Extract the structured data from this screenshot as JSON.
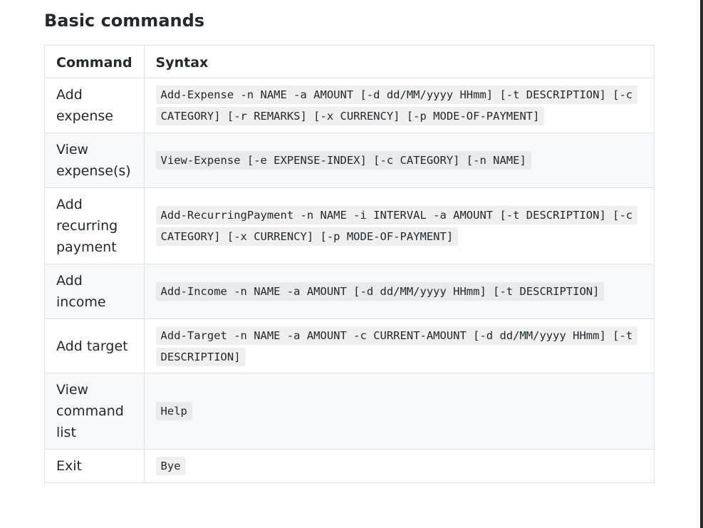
{
  "heading": "Basic commands",
  "table": {
    "headers": {
      "command": "Command",
      "syntax": "Syntax"
    },
    "rows": [
      {
        "command": "Add expense",
        "syntax": "Add-Expense -n NAME -a AMOUNT [-d dd/MM/yyyy HHmm] [-t DESCRIPTION] [-c CATEGORY] [-r REMARKS] [-x CURRENCY] [-p MODE-OF-PAYMENT]"
      },
      {
        "command": "View expense(s)",
        "syntax": "View-Expense [-e EXPENSE-INDEX] [-c CATEGORY] [-n NAME]"
      },
      {
        "command": "Add recurring payment",
        "syntax": "Add-RecurringPayment -n NAME -i INTERVAL -a AMOUNT [-t DESCRIPTION] [-c CATEGORY] [-x CURRENCY] [-p MODE-OF-PAYMENT]"
      },
      {
        "command": "Add income",
        "syntax": "Add-Income -n NAME -a AMOUNT [-d dd/MM/yyyy HHmm] [-t DESCRIPTION]"
      },
      {
        "command": "Add target",
        "syntax": "Add-Target -n NAME -a AMOUNT -c CURRENT-AMOUNT [-d dd/MM/yyyy HHmm] [-t DESCRIPTION]"
      },
      {
        "command": "View command list",
        "syntax": "Help"
      },
      {
        "command": "Exit",
        "syntax": "Bye"
      }
    ]
  },
  "colors": {
    "border": "#dfe2e5",
    "alt_row_bg": "#f6f8fa",
    "code_bg": "#efefef",
    "text": "#24292e"
  }
}
